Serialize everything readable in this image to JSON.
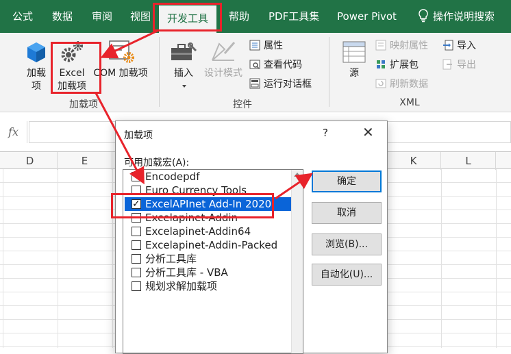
{
  "tabs": [
    "公式",
    "数据",
    "审阅",
    "视图",
    "开发工具",
    "帮助",
    "PDF工具集",
    "Power Pivot"
  ],
  "tell_me": "操作说明搜索",
  "ribbon": {
    "addins_group": {
      "addins_btn": "加载项",
      "excel_addins_line1": "Excel",
      "excel_addins_line2": "加载项",
      "com_addins": "COM 加载项",
      "group_label": "加载项"
    },
    "controls_group": {
      "insert": "插入",
      "design_mode": "设计模式",
      "properties": "属性",
      "view_code": "查看代码",
      "run_dialog": "运行对话框",
      "group_label": "控件"
    },
    "xml_group": {
      "source": "源",
      "map_properties": "映射属性",
      "expansion_packs": "扩展包",
      "refresh_data": "刷新数据",
      "import": "导入",
      "export": "导出",
      "group_label": "XML"
    }
  },
  "formula_bar": {
    "fx": "fx"
  },
  "columns": [
    "D",
    "E",
    "K",
    "L"
  ],
  "dialog": {
    "title": "加载项",
    "help": "?",
    "close": "✕",
    "list_label": "可用加载宏(A):",
    "items": [
      {
        "label": "Encodepdf",
        "checked": false
      },
      {
        "label": "Euro Currency Tools",
        "checked": false
      },
      {
        "label": "ExcelAPInet Add-In 2020",
        "checked": true
      },
      {
        "label": "Excelapinet-Addin",
        "checked": false
      },
      {
        "label": "Excelapinet-Addin64",
        "checked": false
      },
      {
        "label": "Excelapinet-Addin-Packed",
        "checked": false
      },
      {
        "label": "分析工具库",
        "checked": false
      },
      {
        "label": "分析工具库 - VBA",
        "checked": false
      },
      {
        "label": "规划求解加载项",
        "checked": false
      }
    ],
    "buttons": {
      "ok": "确定",
      "cancel": "取消",
      "browse": "浏览(B)...",
      "automation": "自动化(U)..."
    }
  },
  "colors": {
    "excel_green": "#217346",
    "highlight_red": "#e8232b",
    "selection_blue": "#0a64d8"
  }
}
